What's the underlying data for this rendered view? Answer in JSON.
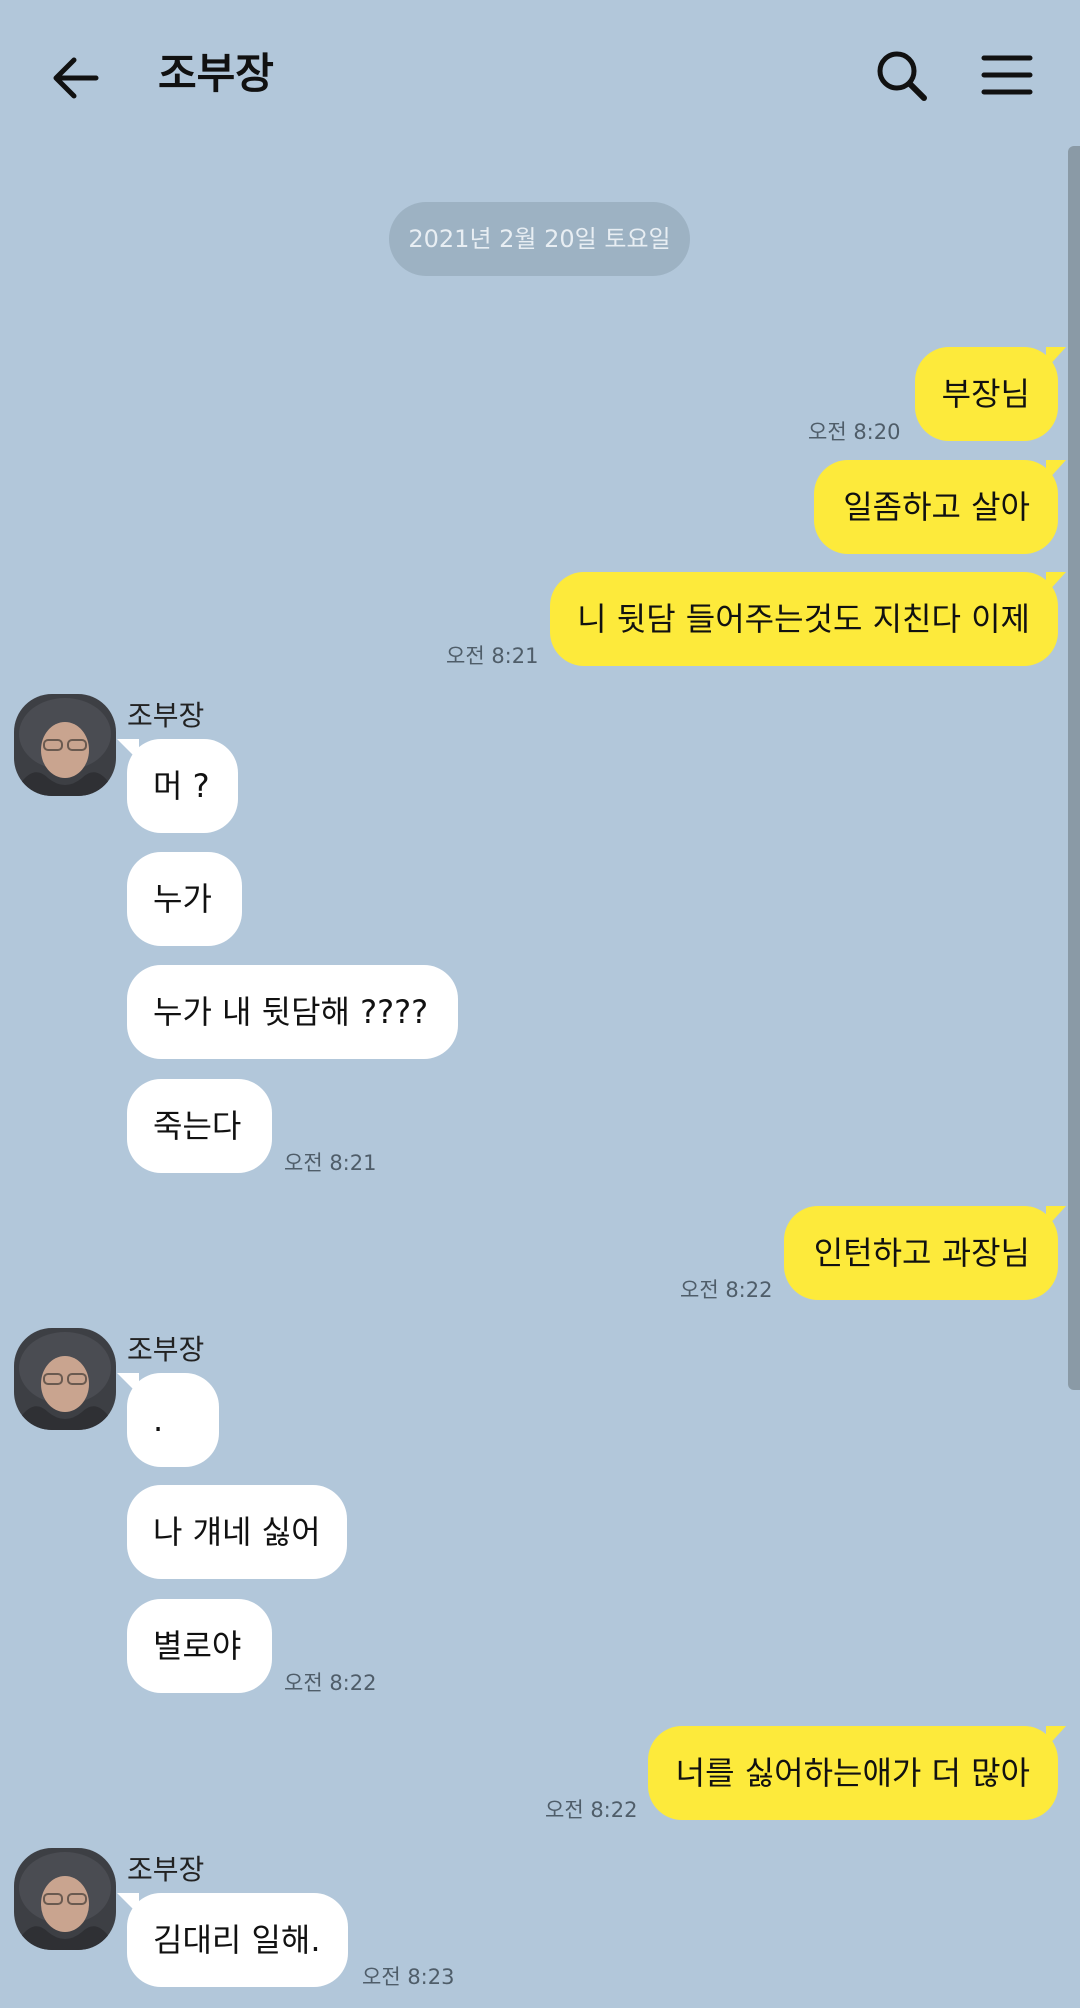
{
  "header": {
    "title": "조부장"
  },
  "date_divider": "2021년 2월 20일 토요일",
  "messages": {
    "m1": {
      "text": "부장님",
      "time": "오전 8:20"
    },
    "m2": {
      "text": "일좀하고 살아"
    },
    "m3": {
      "text": "니 뒷담 들어주는것도 지친다 이제",
      "time": "오전 8:21"
    },
    "g1": {
      "sender": "조부장",
      "items": [
        "머 ?",
        "누가",
        "누가 내 뒷담해 ????",
        "죽는다"
      ],
      "time": "오전 8:21"
    },
    "m4": {
      "text": "인턴하고 과장님",
      "time": "오전 8:22"
    },
    "g2": {
      "sender": "조부장",
      "items": [
        ".",
        "나 걔네 싫어",
        "별로야"
      ],
      "time": "오전 8:22"
    },
    "m5": {
      "text": "너를 싫어하는애가 더 많아",
      "time": "오전 8:22"
    },
    "g3": {
      "sender": "조부장",
      "items": [
        "김대리 일해."
      ],
      "time": "오전 8:23"
    }
  },
  "colors": {
    "background": "#b2c7da",
    "my_bubble": "#fdea3b",
    "their_bubble": "#ffffff",
    "date_pill": "#9db2c3"
  },
  "icons": {
    "back": "arrow-left-icon",
    "search": "search-icon",
    "menu": "hamburger-menu-icon"
  }
}
